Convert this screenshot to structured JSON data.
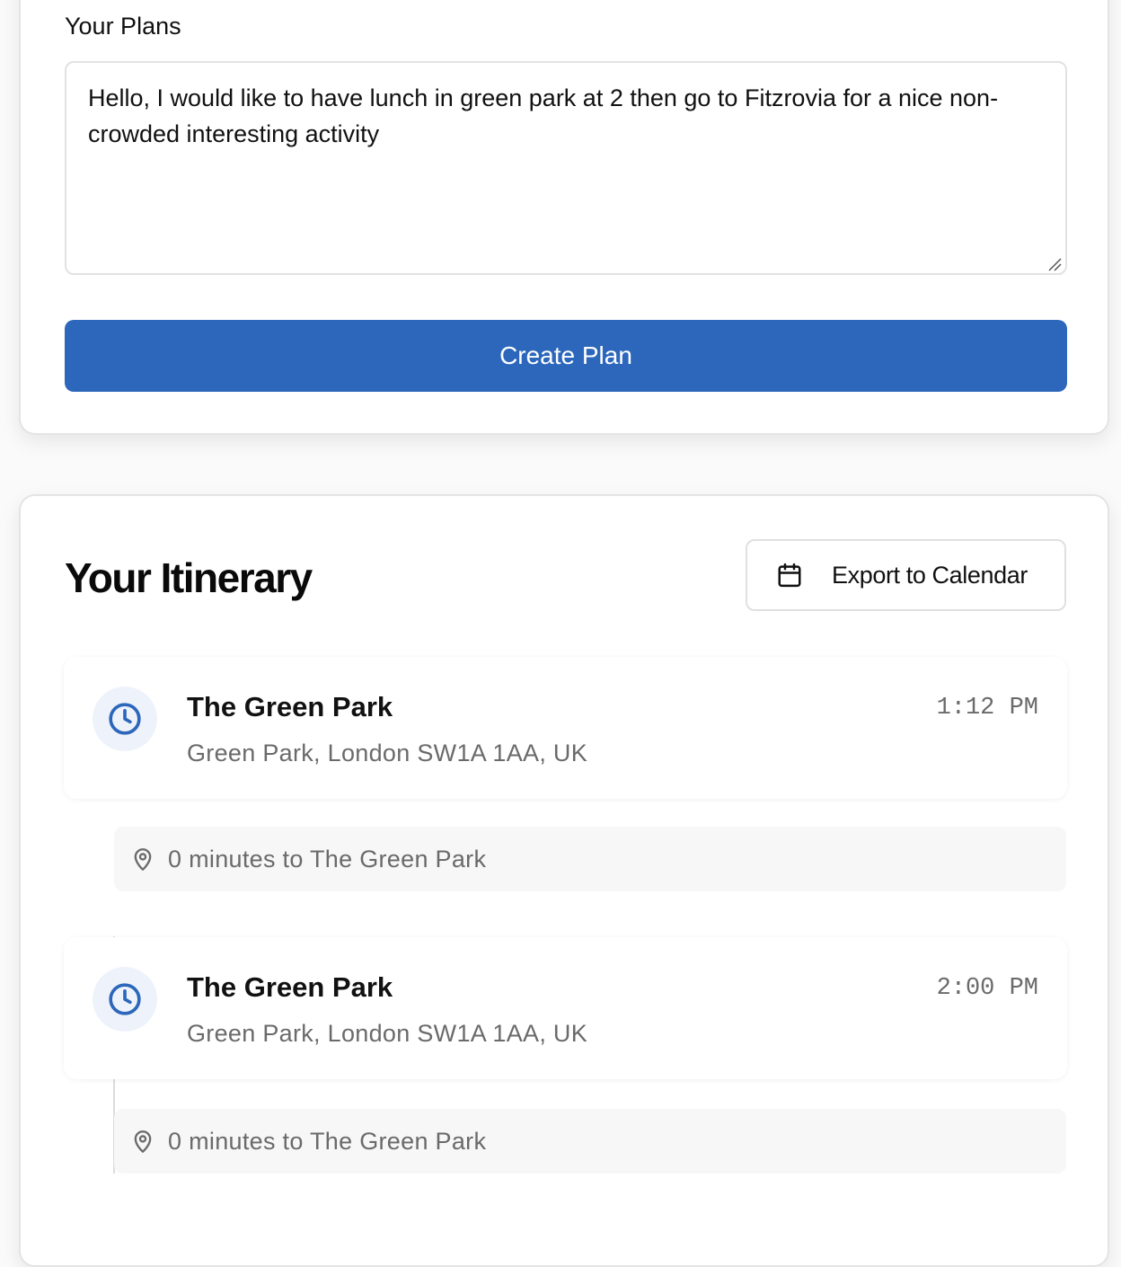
{
  "plans": {
    "label": "Your Plans",
    "text": "Hello, I would like to have lunch in green park at 2 then go to Fitzrovia for a nice non-crowded interesting activity",
    "create_button": "Create Plan"
  },
  "itinerary": {
    "title": "Your Itinerary",
    "export_button": "Export to Calendar",
    "items": [
      {
        "name": "The Green Park",
        "address": "Green Park, London SW1A 1AA, UK",
        "time": "1:12 PM",
        "travel": "0 minutes to The Green Park"
      },
      {
        "name": "The Green Park",
        "address": "Green Park, London SW1A 1AA, UK",
        "time": "2:00 PM",
        "travel": "0 minutes to The Green Park"
      }
    ]
  },
  "colors": {
    "primary": "#2c67bb",
    "icon_bg": "#eef3fb",
    "muted_text": "#6a6a6a"
  },
  "icons": {
    "calendar": "calendar-icon",
    "clock": "clock-icon",
    "location": "map-pin-icon"
  }
}
